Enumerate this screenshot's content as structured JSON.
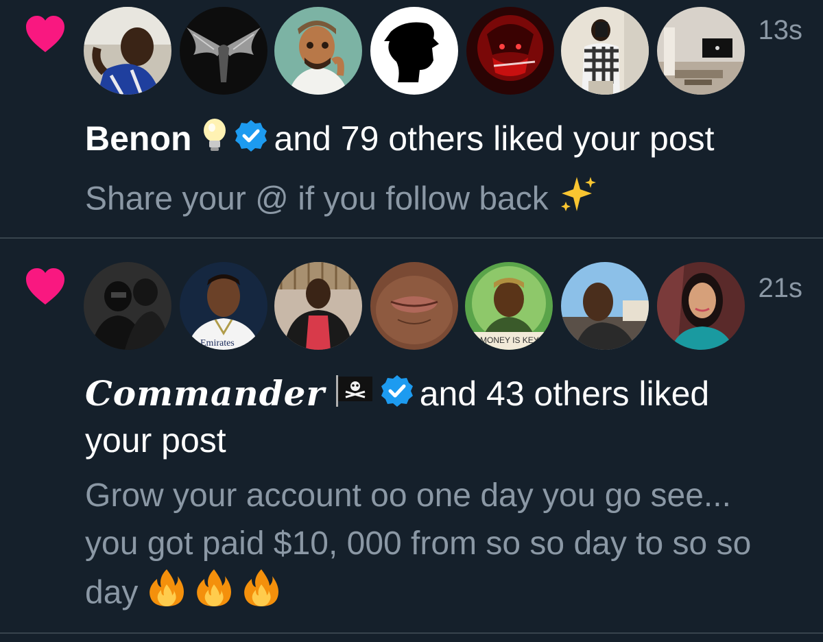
{
  "notifications": [
    {
      "timestamp": "13s",
      "name": "Benon",
      "rest": "and 79 others liked your post",
      "post_text": "Share your @ if you follow back",
      "name_emoji": "lightbulb-icon",
      "text_emoji": "sparkles-icon",
      "avatars": [
        "avatar-man-blue-jersey",
        "avatar-black-eagle",
        "avatar-cartoon-man-cap",
        "avatar-silhouette-cap",
        "avatar-red-anime",
        "avatar-mirror-selfie",
        "avatar-living-room"
      ]
    },
    {
      "timestamp": "21s",
      "name": "Commander",
      "rest_line1": "and 43 others liked",
      "rest_line2": "your post",
      "post_text": "Grow your account oo one day you go see... you got paid $10, 000 from so so day to so so day",
      "name_emoji": "pirate-flag-icon",
      "text_emoji": "fire-icon",
      "avatars": [
        "avatar-dark-group",
        "avatar-cartoon-footballer",
        "avatar-man-red-shirt",
        "avatar-lips-closeup",
        "avatar-cartoon-boy-money",
        "avatar-man-outdoor",
        "avatar-woman-teal"
      ]
    }
  ],
  "colors": {
    "background": "#15202b",
    "heart": "#f91880",
    "verified": "#1d9bf0",
    "secondary_text": "#8b98a5",
    "divider": "#38444d"
  }
}
